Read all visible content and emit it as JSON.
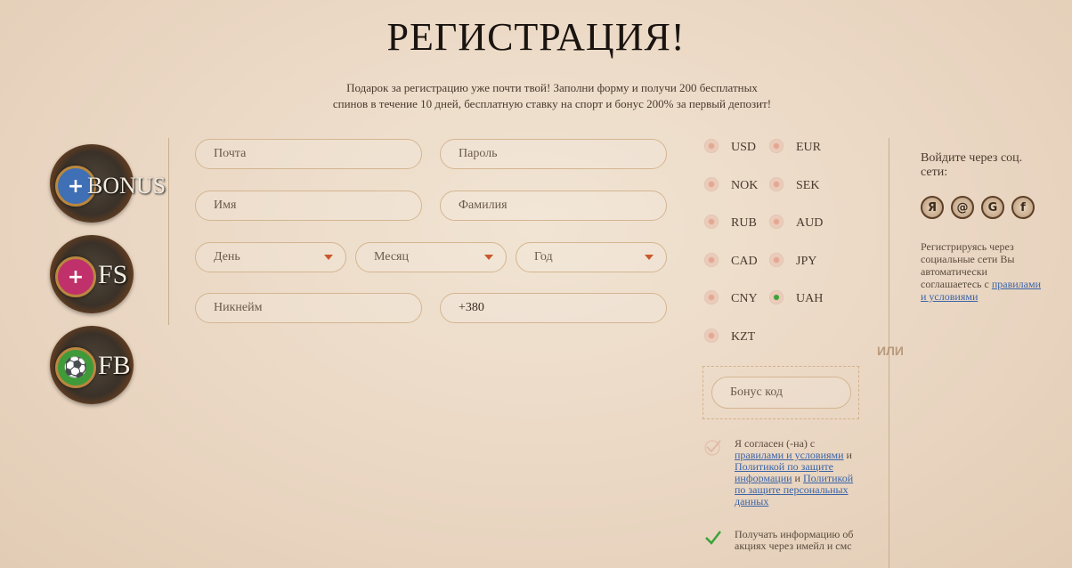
{
  "page": {
    "title": "РЕГИСТРАЦИЯ!",
    "subtitle_line1": "Подарок за регистрацию уже почти твой! Заполни форму и получи 200 бесплатных",
    "subtitle_line2": "спинов в течение 10 дней, бесплатную ставку на спорт и бонус 200% за первый депозит!"
  },
  "badges": [
    {
      "label": "BONUS",
      "symbol": "+",
      "icon": "bonus-icon",
      "gem_color": "#3f6fb5"
    },
    {
      "label": "FS",
      "symbol": "+",
      "icon": "free-spins-icon",
      "gem_color": "#c0306a"
    },
    {
      "label": "FB",
      "symbol": "⚽",
      "icon": "free-bet-icon",
      "gem_color": "#3f9a3a"
    }
  ],
  "form": {
    "email_placeholder": "Почта",
    "password_placeholder": "Пароль",
    "name_placeholder": "Имя",
    "surname_placeholder": "Фамилия",
    "day_placeholder": "День",
    "month_placeholder": "Месяц",
    "year_placeholder": "Год",
    "nickname_placeholder": "Никнейм",
    "phone_value": "+380"
  },
  "currencies": [
    {
      "code": "USD",
      "selected": false
    },
    {
      "code": "EUR",
      "selected": false
    },
    {
      "code": "NOK",
      "selected": false
    },
    {
      "code": "SEK",
      "selected": false
    },
    {
      "code": "RUB",
      "selected": false
    },
    {
      "code": "AUD",
      "selected": false
    },
    {
      "code": "CAD",
      "selected": false
    },
    {
      "code": "JPY",
      "selected": false
    },
    {
      "code": "CNY",
      "selected": false
    },
    {
      "code": "UAH",
      "selected": true
    },
    {
      "code": "KZT",
      "selected": false
    }
  ],
  "bonus_code_placeholder": "Бонус код",
  "or_label": "ИЛИ",
  "agreement": {
    "text1": "Я согласен (-на) с",
    "link1": "правилами и условиями",
    "text2": "и",
    "link2": "Политикой по защите информации",
    "text3": "и",
    "link3": "Политикой по защите персональных данных"
  },
  "promo_consent": {
    "text": "Получать информацию об акциях через имейл и смс"
  },
  "social": {
    "title": "Войдите через соц. сети:",
    "buttons": [
      {
        "glyph": "Я",
        "icon": "yandex-icon"
      },
      {
        "glyph": "@",
        "icon": "mail-icon"
      },
      {
        "glyph": "G",
        "icon": "google-icon"
      },
      {
        "glyph": "f",
        "icon": "facebook-icon"
      }
    ],
    "note": "Регистрируясь через социальные сети Вы автоматически соглашаетесь с",
    "note_link": "правилами и условиями"
  },
  "colors": {
    "accent": "#c7592b",
    "link": "#3a64a8",
    "check_green": "#3aa33a",
    "field_border": "#d4b591"
  }
}
